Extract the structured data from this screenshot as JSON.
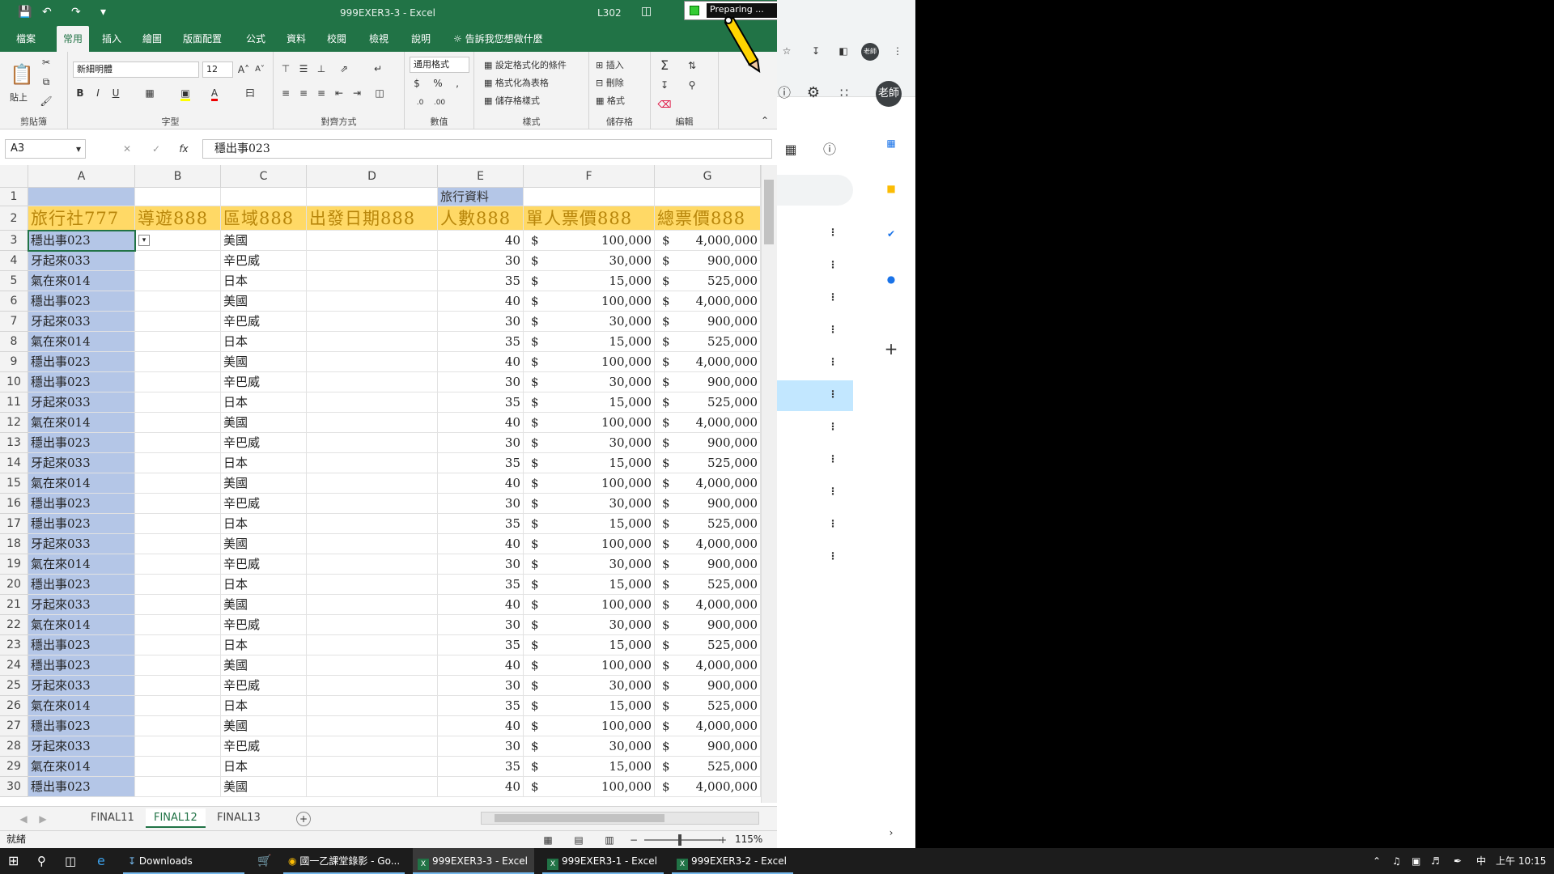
{
  "window": {
    "title": "999EXER3-3  -  Excel",
    "user": "L302"
  },
  "recorder": {
    "status": "Preparing ..."
  },
  "tabs": [
    "檔案",
    "常用",
    "插入",
    "繪圖",
    "版面配置",
    "公式",
    "資料",
    "校閱",
    "檢視",
    "說明"
  ],
  "tell_me": "告訴我您想做什麼",
  "ribbon": {
    "clipboard": "剪貼簿",
    "paste": "貼上",
    "font_group": "字型",
    "font_name": "新細明體",
    "font_size": "12",
    "align_group": "對齊方式",
    "number_group": "數值",
    "number_format": "通用格式",
    "styles_group": "樣式",
    "cond_format": "設定格式化的條件",
    "format_table": "格式化為表格",
    "cell_styles": "儲存格樣式",
    "cells_group": "儲存格",
    "insert": "插入",
    "delete": "刪除",
    "format": "格式",
    "edit_group": "編輯"
  },
  "formula_bar": {
    "cell_ref": "A3",
    "content": "穩出事023"
  },
  "columns": [
    "A",
    "B",
    "C",
    "D",
    "E",
    "F",
    "G"
  ],
  "row1_title": "旅行資料",
  "headers": [
    "旅行社777",
    "導遊888",
    "區域888",
    "出發日期888",
    "人數888",
    "單人票價888",
    "總票價888"
  ],
  "rows": [
    {
      "n": "3",
      "a": "穩出事023",
      "c": "美國",
      "e": "40",
      "f": "100,000",
      "g": "4,000,000"
    },
    {
      "n": "4",
      "a": "牙起來033",
      "c": "辛巴威",
      "e": "30",
      "f": "30,000",
      "g": "900,000"
    },
    {
      "n": "5",
      "a": "氣在來014",
      "c": "日本",
      "e": "35",
      "f": "15,000",
      "g": "525,000"
    },
    {
      "n": "6",
      "a": "穩出事023",
      "c": "美國",
      "e": "40",
      "f": "100,000",
      "g": "4,000,000"
    },
    {
      "n": "7",
      "a": "牙起來033",
      "c": "辛巴威",
      "e": "30",
      "f": "30,000",
      "g": "900,000"
    },
    {
      "n": "8",
      "a": "氣在來014",
      "c": "日本",
      "e": "35",
      "f": "15,000",
      "g": "525,000"
    },
    {
      "n": "9",
      "a": "穩出事023",
      "c": "美國",
      "e": "40",
      "f": "100,000",
      "g": "4,000,000"
    },
    {
      "n": "10",
      "a": "穩出事023",
      "c": "辛巴威",
      "e": "30",
      "f": "30,000",
      "g": "900,000"
    },
    {
      "n": "11",
      "a": "牙起來033",
      "c": "日本",
      "e": "35",
      "f": "15,000",
      "g": "525,000"
    },
    {
      "n": "12",
      "a": "氣在來014",
      "c": "美國",
      "e": "40",
      "f": "100,000",
      "g": "4,000,000"
    },
    {
      "n": "13",
      "a": "穩出事023",
      "c": "辛巴威",
      "e": "30",
      "f": "30,000",
      "g": "900,000"
    },
    {
      "n": "14",
      "a": "牙起來033",
      "c": "日本",
      "e": "35",
      "f": "15,000",
      "g": "525,000"
    },
    {
      "n": "15",
      "a": "氣在來014",
      "c": "美國",
      "e": "40",
      "f": "100,000",
      "g": "4,000,000"
    },
    {
      "n": "16",
      "a": "穩出事023",
      "c": "辛巴威",
      "e": "30",
      "f": "30,000",
      "g": "900,000"
    },
    {
      "n": "17",
      "a": "穩出事023",
      "c": "日本",
      "e": "35",
      "f": "15,000",
      "g": "525,000"
    },
    {
      "n": "18",
      "a": "牙起來033",
      "c": "美國",
      "e": "40",
      "f": "100,000",
      "g": "4,000,000"
    },
    {
      "n": "19",
      "a": "氣在來014",
      "c": "辛巴威",
      "e": "30",
      "f": "30,000",
      "g": "900,000"
    },
    {
      "n": "20",
      "a": "穩出事023",
      "c": "日本",
      "e": "35",
      "f": "15,000",
      "g": "525,000"
    },
    {
      "n": "21",
      "a": "牙起來033",
      "c": "美國",
      "e": "40",
      "f": "100,000",
      "g": "4,000,000"
    },
    {
      "n": "22",
      "a": "氣在來014",
      "c": "辛巴威",
      "e": "30",
      "f": "30,000",
      "g": "900,000"
    },
    {
      "n": "23",
      "a": "穩出事023",
      "c": "日本",
      "e": "35",
      "f": "15,000",
      "g": "525,000"
    },
    {
      "n": "24",
      "a": "穩出事023",
      "c": "美國",
      "e": "40",
      "f": "100,000",
      "g": "4,000,000"
    },
    {
      "n": "25",
      "a": "牙起來033",
      "c": "辛巴威",
      "e": "30",
      "f": "30,000",
      "g": "900,000"
    },
    {
      "n": "26",
      "a": "氣在來014",
      "c": "日本",
      "e": "35",
      "f": "15,000",
      "g": "525,000"
    },
    {
      "n": "27",
      "a": "穩出事023",
      "c": "美國",
      "e": "40",
      "f": "100,000",
      "g": "4,000,000"
    },
    {
      "n": "28",
      "a": "牙起來033",
      "c": "辛巴威",
      "e": "30",
      "f": "30,000",
      "g": "900,000"
    },
    {
      "n": "29",
      "a": "氣在來014",
      "c": "日本",
      "e": "35",
      "f": "15,000",
      "g": "525,000"
    },
    {
      "n": "30",
      "a": "穩出事023",
      "c": "美國",
      "e": "40",
      "f": "100,000",
      "g": "4,000,000"
    }
  ],
  "currency_symbol": "$",
  "sheets": [
    "FINAL11",
    "FINAL12",
    "FINAL13"
  ],
  "status": {
    "ready": "就緒",
    "zoom": "115%"
  },
  "chrome": {
    "avatar": "老師"
  },
  "taskbar": {
    "items": [
      "Downloads",
      "國一乙課堂錄影 - Go...",
      "999EXER3-3 - Excel",
      "999EXER3-1 - Excel",
      "999EXER3-2 - Excel"
    ],
    "ime": "中",
    "clock": "上午 10:15"
  },
  "colors": {
    "excel_green": "#217346",
    "header_fill": "#ffd966",
    "selection": "#b4c6e7"
  }
}
